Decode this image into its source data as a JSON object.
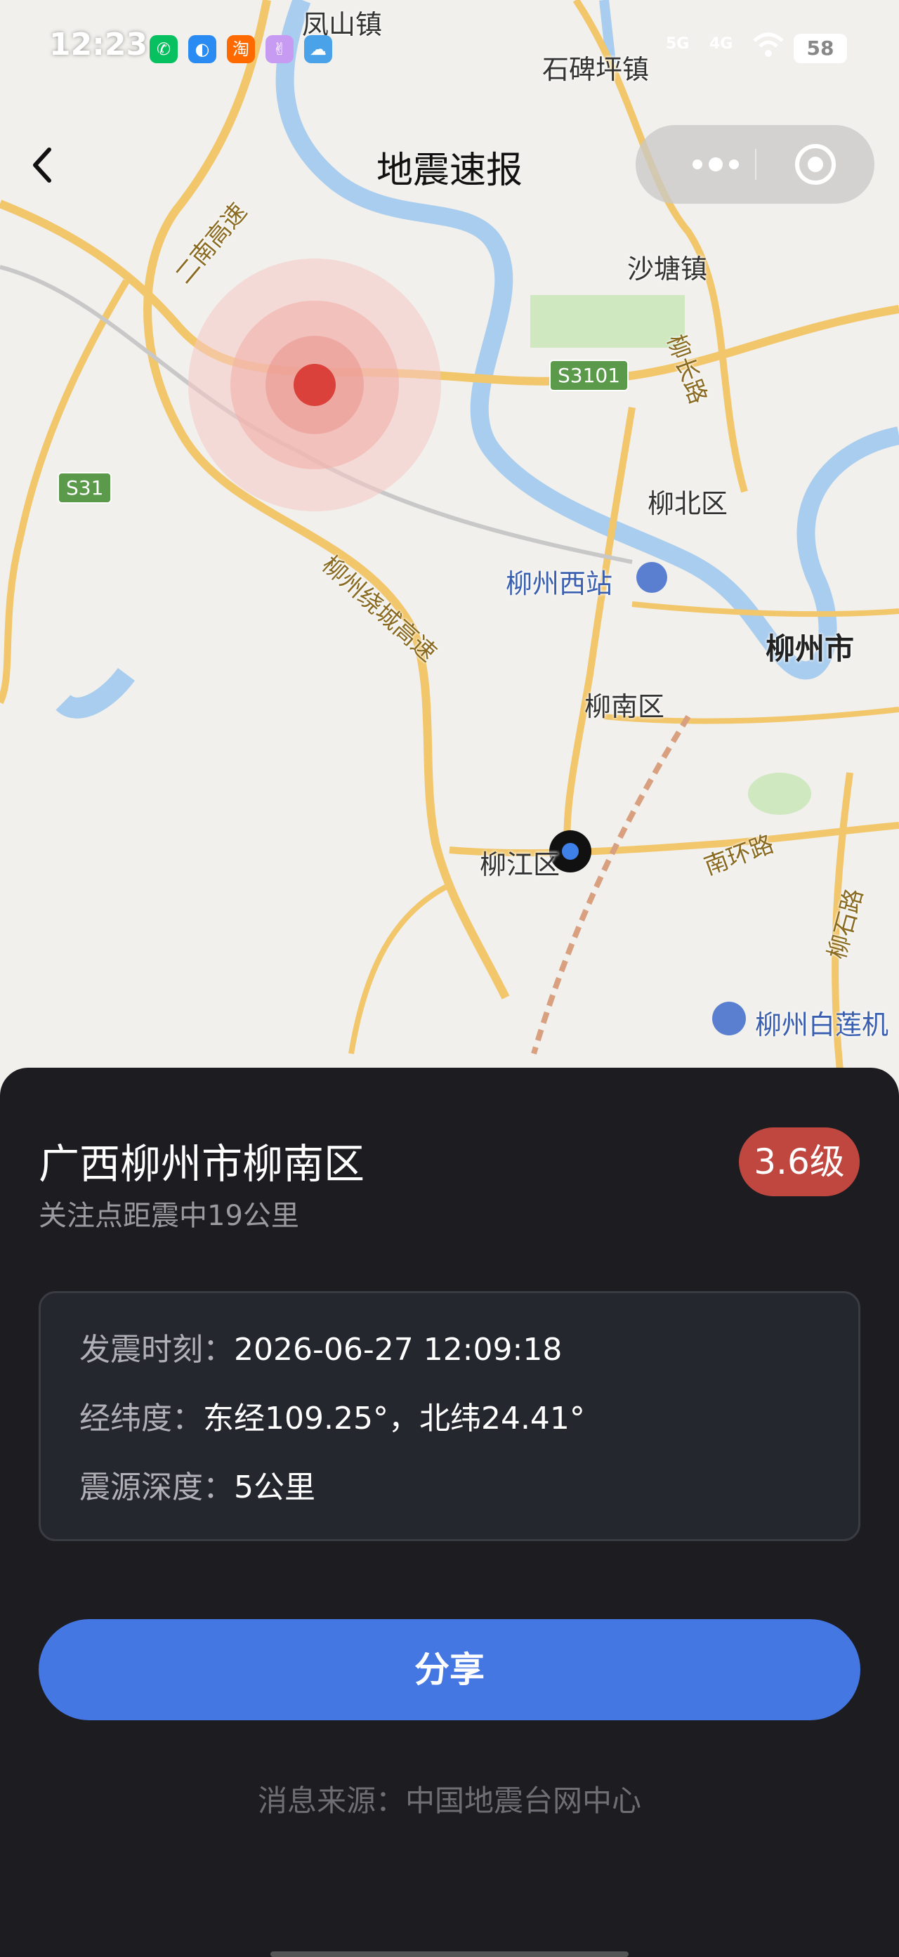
{
  "status_bar": {
    "time": "12:23",
    "network_5g": "5G",
    "network_4g": "4G",
    "battery": "58",
    "app_icons": [
      "wechat-icon",
      "browser-icon",
      "taobao-icon",
      "app-icon",
      "weather-icon"
    ]
  },
  "nav": {
    "title": "地震速报",
    "back_icon": "chevron-left-icon",
    "more_icon": "more-dots-icon",
    "close_icon": "target-circle-icon"
  },
  "map": {
    "places": {
      "fengshan": "凤山镇",
      "shibeiping": "石碑坪镇",
      "shatang": "沙塘镇",
      "liubei": "柳北区",
      "liuzhou_west_station": "柳州西站",
      "liuzhou_city": "柳州市",
      "liunan": "柳南区",
      "liujiang": "柳江区",
      "airport": "柳州白莲机"
    },
    "roads": {
      "ernan": "二南高速",
      "ring": "柳州绕城高速",
      "liuchang": "柳长路",
      "nanhuan": "南环路",
      "liushi": "柳石路",
      "s3101": "S3101",
      "s31": "S31"
    },
    "colors": {
      "epicenter": "#d9413a",
      "water": "#a9cdee",
      "highway": "#f2c66a"
    }
  },
  "quake": {
    "location": "广西柳州市柳南区",
    "distance_text": "关注点距震中19公里",
    "magnitude": "3.6级",
    "time_label": "发震时刻：",
    "time_value": "2026-06-27 12:09:18",
    "coord_label": "经纬度：",
    "coord_value": "东经109.25°，北纬24.41°",
    "depth_label": "震源深度：",
    "depth_value": "5公里"
  },
  "actions": {
    "share_label": "分享"
  },
  "footer": {
    "source": "消息来源：中国地震台网中心"
  }
}
